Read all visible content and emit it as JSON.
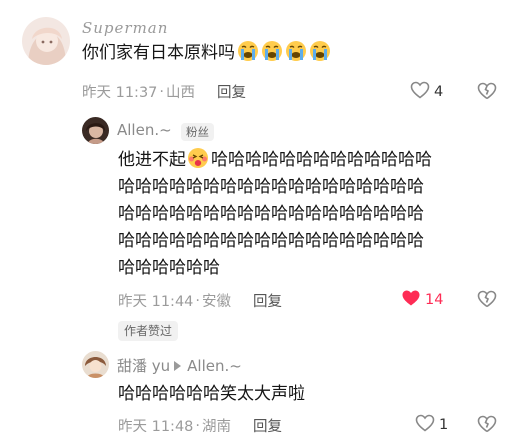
{
  "comments": [
    {
      "author": "Superman",
      "text": "你们家有日本原料吗",
      "emojis": [
        "loudly-crying-face",
        "loudly-crying-face",
        "loudly-crying-face",
        "loudly-crying-face"
      ],
      "time": "昨天 11:37",
      "location": "山西",
      "reply_label": "回复",
      "likes": "4"
    },
    {
      "author": "Allen.~",
      "badge": "粉丝",
      "text_before_emoji": "他进不起",
      "emoji": "cheeky-face",
      "text_lines": [
        "哈哈哈哈哈哈哈哈哈哈哈哈哈",
        "哈哈哈哈哈哈哈哈哈哈哈哈哈哈哈哈哈哈",
        "哈哈哈哈哈哈哈哈哈哈哈哈哈哈哈哈哈哈",
        "哈哈哈哈哈哈哈哈哈哈哈哈哈哈哈哈哈哈",
        "哈哈哈哈哈哈"
      ],
      "time": "昨天 11:44",
      "location": "安徽",
      "reply_label": "回复",
      "likes": "14",
      "liked": true,
      "author_liked_label": "作者赞过"
    },
    {
      "author": "甜潘 yu",
      "reply_to": "Allen.~",
      "text": "哈哈哈哈哈哈笑太大声啦",
      "time": "昨天 11:48",
      "location": "湖南",
      "reply_label": "回复",
      "likes": "1"
    }
  ],
  "colors": {
    "like_active": "#fe2c55",
    "meta_text": "#9b9b9b"
  }
}
